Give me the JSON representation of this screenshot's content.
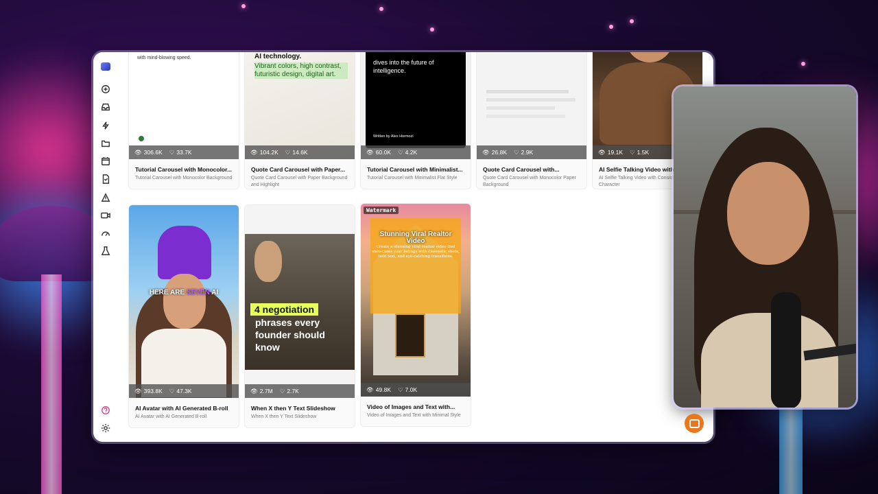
{
  "cards_row1": [
    {
      "title": "Tutorial Carousel with Monocolor...",
      "subtitle": "Tutorial Carousel with Monocolor Background",
      "views": "306.6K",
      "likes": "33.7K",
      "thumb_text": "with mind-blowing speed."
    },
    {
      "title": "Quote Card Carousel with Paper...",
      "subtitle": "Quote Card Carousel with Paper Background and Highlight",
      "views": "104.2K",
      "likes": "14.6K",
      "thumb_heading": "AI technology.",
      "thumb_highlight": "Vibrant colors, high contrast, futuristic design, digital art."
    },
    {
      "title": "Tutorial Carousel with Minimalist...",
      "subtitle": "Tutorial Carousel with Minimalist Flat Style",
      "views": "60.0K",
      "likes": "4.2K",
      "thumb_text": "dives into the future of intelligence.",
      "thumb_author": "Written by Alex Hormozi"
    },
    {
      "title": "Quote Card Carousel with...",
      "subtitle": "Quote Card Carousel with Monocolor Paper Background",
      "views": "26.8K",
      "likes": "2.9K"
    },
    {
      "title": "AI Selfie Talking Video with...",
      "subtitle": "AI Selfie Talking Video with Consistent Character",
      "views": "19.1K",
      "likes": "1.5K"
    }
  ],
  "cards_row2": [
    {
      "title": "AI Avatar with AI Generated B-roll",
      "subtitle": "AI Avatar with AI Generated B-roll",
      "views": "393.8K",
      "likes": "47.3K",
      "caption_a": "HERE ARE ",
      "caption_b": "SEVEN",
      "caption_c": " AI"
    },
    {
      "title": "When X then Y Text Slideshow",
      "subtitle": "When X then Y Text Slideshow",
      "views": "2.7M",
      "likes": "2.7K",
      "chip": "4 negotiation",
      "overlay": "phrases every founder should know"
    },
    {
      "title": "Video of Images and Text with...",
      "subtitle": "Video of Images and Text with Minimal Style",
      "views": "49.8K",
      "likes": "7.0K",
      "watermark": "Watermark",
      "heading": "Stunning Viral Realtor Video",
      "body": "Create a stunning viral realtor video that showcases your listings with cinematic shots, bold text, and eye-catching transitions."
    }
  ],
  "colors": {
    "accent": "#e8771d",
    "stats_bar": "#505050",
    "highlight_chip": "#e7ff5a"
  },
  "sidebar_icons": [
    "logo-icon",
    "plus-circle-icon",
    "inbox-icon",
    "lightning-icon",
    "folder-icon",
    "calendar-icon",
    "document-icon",
    "warning-icon",
    "video-icon",
    "gauge-icon",
    "flask-icon",
    "help-icon",
    "settings-icon"
  ]
}
